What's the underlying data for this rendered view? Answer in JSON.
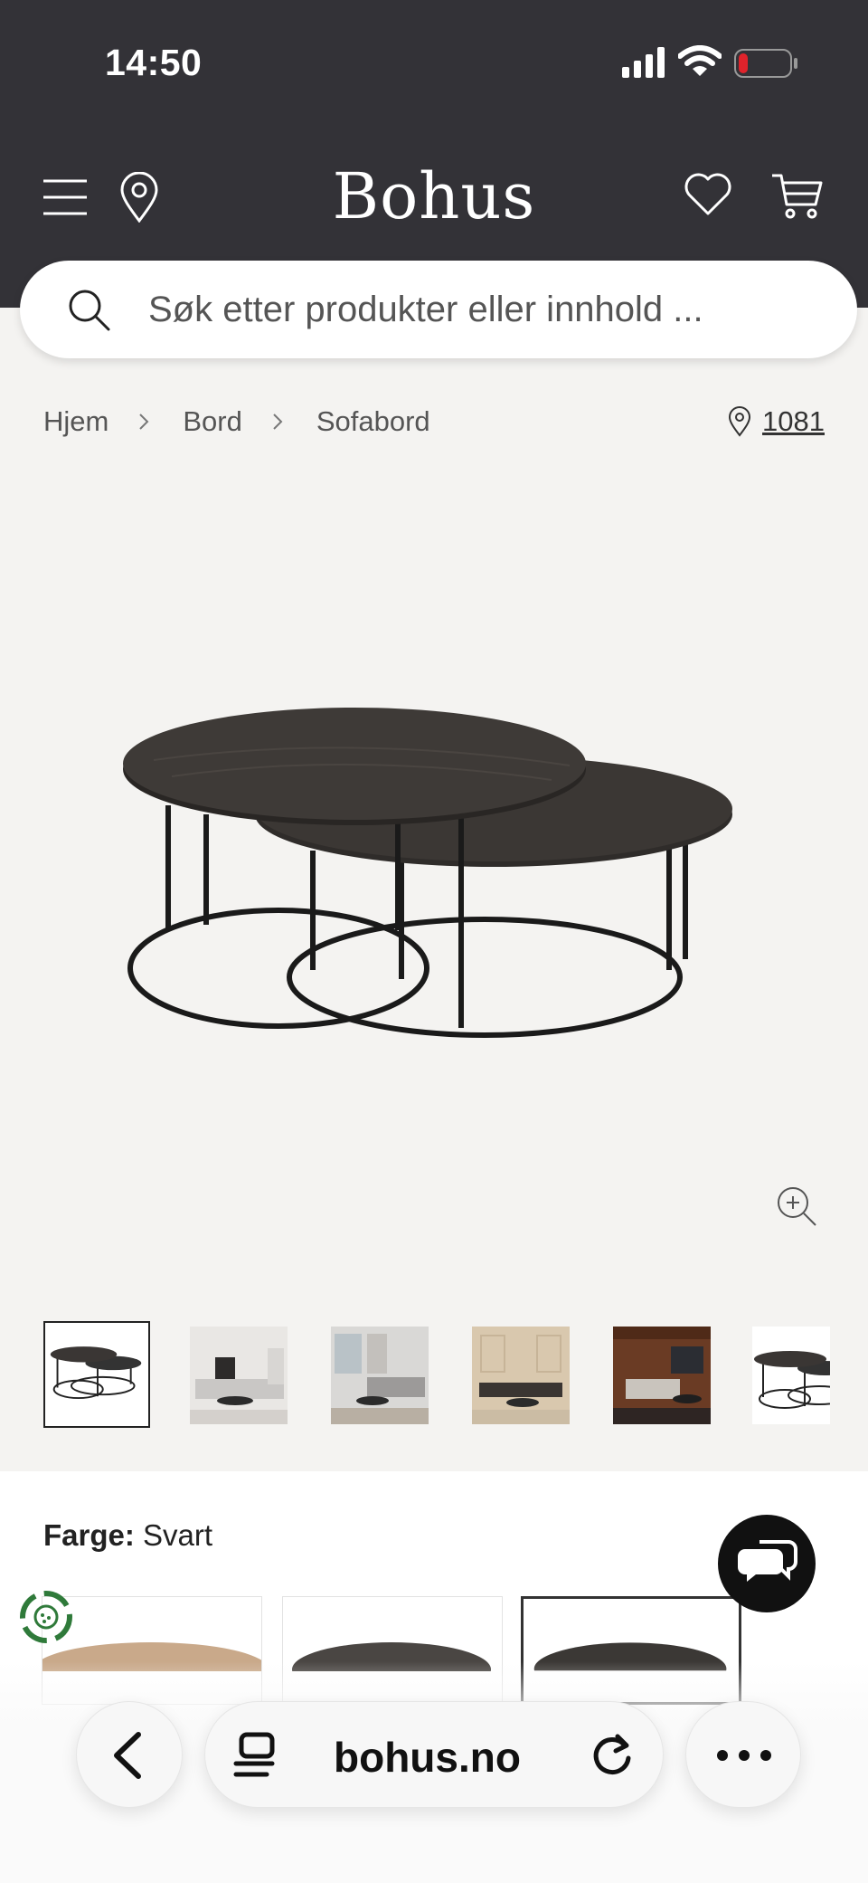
{
  "status_bar": {
    "time": "14:50"
  },
  "header": {
    "logo": "Bohus",
    "icons": [
      "menu-icon",
      "location-pin-icon",
      "heart-icon",
      "cart-icon"
    ]
  },
  "search": {
    "placeholder": "Søk etter produkter eller innhold ..."
  },
  "breadcrumb": {
    "items": [
      "Hjem",
      "Bord",
      "Sofabord"
    ],
    "location_code": "1081"
  },
  "gallery": {
    "thumbnail_count": 6,
    "active_index": 0
  },
  "options": {
    "color_label": "Farge:",
    "color_value": "Svart"
  },
  "browser": {
    "url": "bohus.no"
  },
  "colors": {
    "header_bg": "#333237",
    "page_bg": "#f4f3f1",
    "accent_dark": "#111111"
  }
}
